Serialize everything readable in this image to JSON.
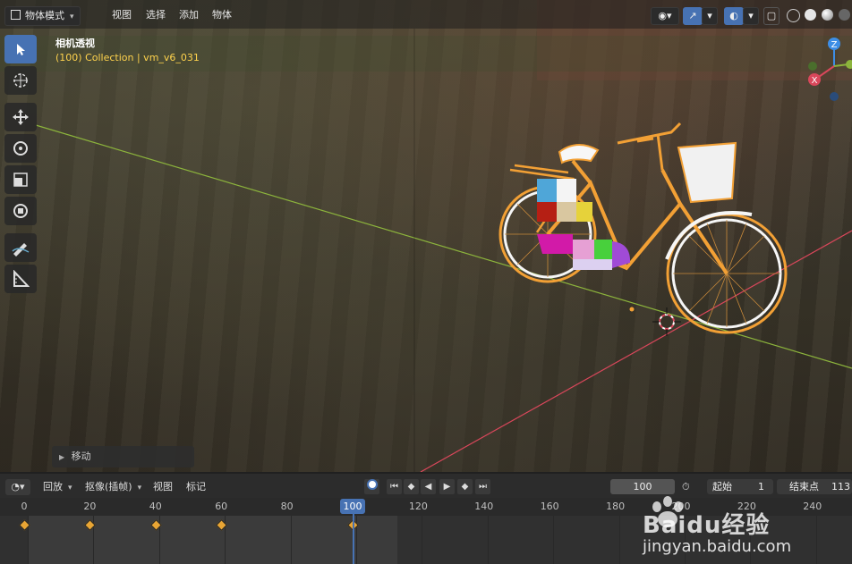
{
  "header": {
    "mode_label": "物体模式",
    "menus": [
      "视图",
      "选择",
      "添加",
      "物体"
    ]
  },
  "overlay": {
    "view_name": "相机透视",
    "collection_info": "(100) Collection | vm_v6_031"
  },
  "gizmo": {
    "z_label": "Z",
    "x_label": "X"
  },
  "operator_panel": {
    "label": "移动"
  },
  "timeline": {
    "menus": [
      "回放",
      "抠像(插帧)",
      "视图",
      "标记"
    ],
    "current_frame": "100",
    "start_label": "起始",
    "start_value": "1",
    "end_label": "结束点",
    "end_value": "113",
    "ruler_ticks": [
      "0",
      "20",
      "40",
      "60",
      "80",
      "100",
      "120",
      "140",
      "160",
      "180",
      "200",
      "220",
      "240"
    ],
    "keyframes": [
      0,
      20,
      40,
      60,
      100
    ],
    "playhead": "100"
  },
  "watermark": {
    "brand": "Baidu经验",
    "url": "jingyan.baidu.com"
  },
  "colors": {
    "accent": "#4772b3",
    "keyframe": "#e8a534",
    "selection_outline": "#f2a035",
    "x_axis": "#d9475b",
    "y_axis": "#8cb43c",
    "z_axis": "#3d8ee6",
    "collection_text": "#ffd34d"
  }
}
